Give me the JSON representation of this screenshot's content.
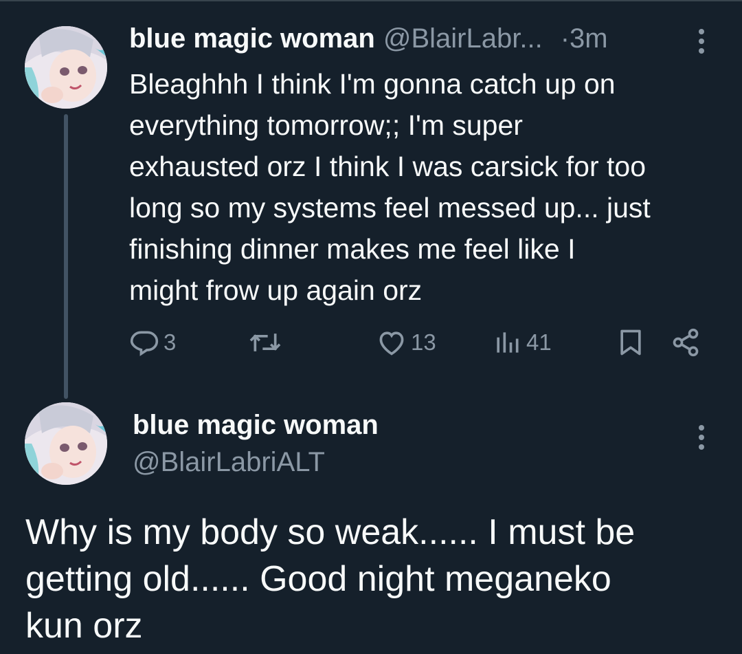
{
  "tweet1": {
    "display_name": "blue magic woman",
    "handle": "@BlairLabr...",
    "separator": "·",
    "time": "3m",
    "text_lines": [
      "Bleaghhh I think I'm gonna catch up on",
      "everything tomorrow;; I'm super",
      "exhausted orz I think I was carsick for too",
      "long so my systems feel messed up... just",
      "finishing dinner makes me feel like I",
      "might frow up again orz"
    ],
    "actions": {
      "reply_icon": "reply-icon",
      "reply_count": "3",
      "retweet_icon": "retweet-icon",
      "like_icon": "heart-icon",
      "like_count": "13",
      "views_icon": "views-chart-icon",
      "views_count": "41",
      "bookmark_icon": "bookmark-icon",
      "share_icon": "share-icon"
    }
  },
  "tweet2": {
    "display_name": "blue magic woman",
    "handle": "@BlairLabriALT",
    "text_lines": [
      "Why is my body so weak...... I must be",
      "getting old...... Good night meganeko",
      "kun orz"
    ]
  },
  "colors": {
    "background": "#15202b",
    "text": "#f7f9f9",
    "muted": "#8b98a5",
    "thread_line": "#425364"
  }
}
